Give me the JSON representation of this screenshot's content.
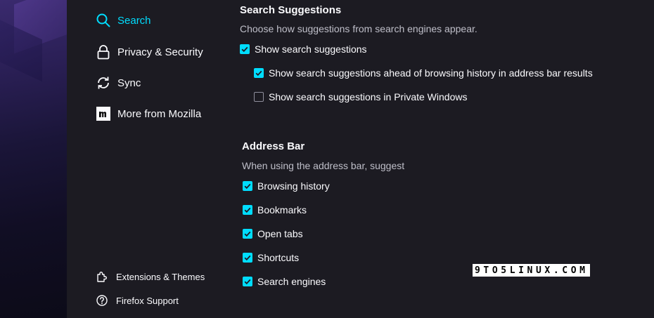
{
  "sidebar": {
    "items": [
      {
        "label": "Search",
        "icon": "search-icon",
        "selected": true
      },
      {
        "label": "Privacy & Security",
        "icon": "lock-icon",
        "selected": false
      },
      {
        "label": "Sync",
        "icon": "sync-icon",
        "selected": false
      },
      {
        "label": "More from Mozilla",
        "icon": "mozilla-icon",
        "selected": false
      }
    ],
    "footer": [
      {
        "label": "Extensions & Themes",
        "icon": "puzzle-icon"
      },
      {
        "label": "Firefox Support",
        "icon": "help-icon"
      }
    ]
  },
  "search_suggestions": {
    "title": "Search Suggestions",
    "description": "Choose how suggestions from search engines appear.",
    "options": [
      {
        "label": "Show search suggestions",
        "checked": true
      },
      {
        "label": "Show search suggestions ahead of browsing history in address bar results",
        "checked": true
      },
      {
        "label": "Show search suggestions in Private Windows",
        "checked": false
      }
    ]
  },
  "address_bar": {
    "title": "Address Bar",
    "description": "When using the address bar, suggest",
    "options": [
      {
        "label": "Browsing history",
        "checked": true
      },
      {
        "label": "Bookmarks",
        "checked": true
      },
      {
        "label": "Open tabs",
        "checked": true
      },
      {
        "label": "Shortcuts",
        "checked": true
      },
      {
        "label": "Search engines",
        "checked": true
      }
    ]
  },
  "watermark": "9TO5LINUX.COM",
  "colors": {
    "accent": "#00ddff",
    "background": "#1c1b22",
    "text": "#fbfbfe",
    "muted_text": "#bfbfc9"
  }
}
